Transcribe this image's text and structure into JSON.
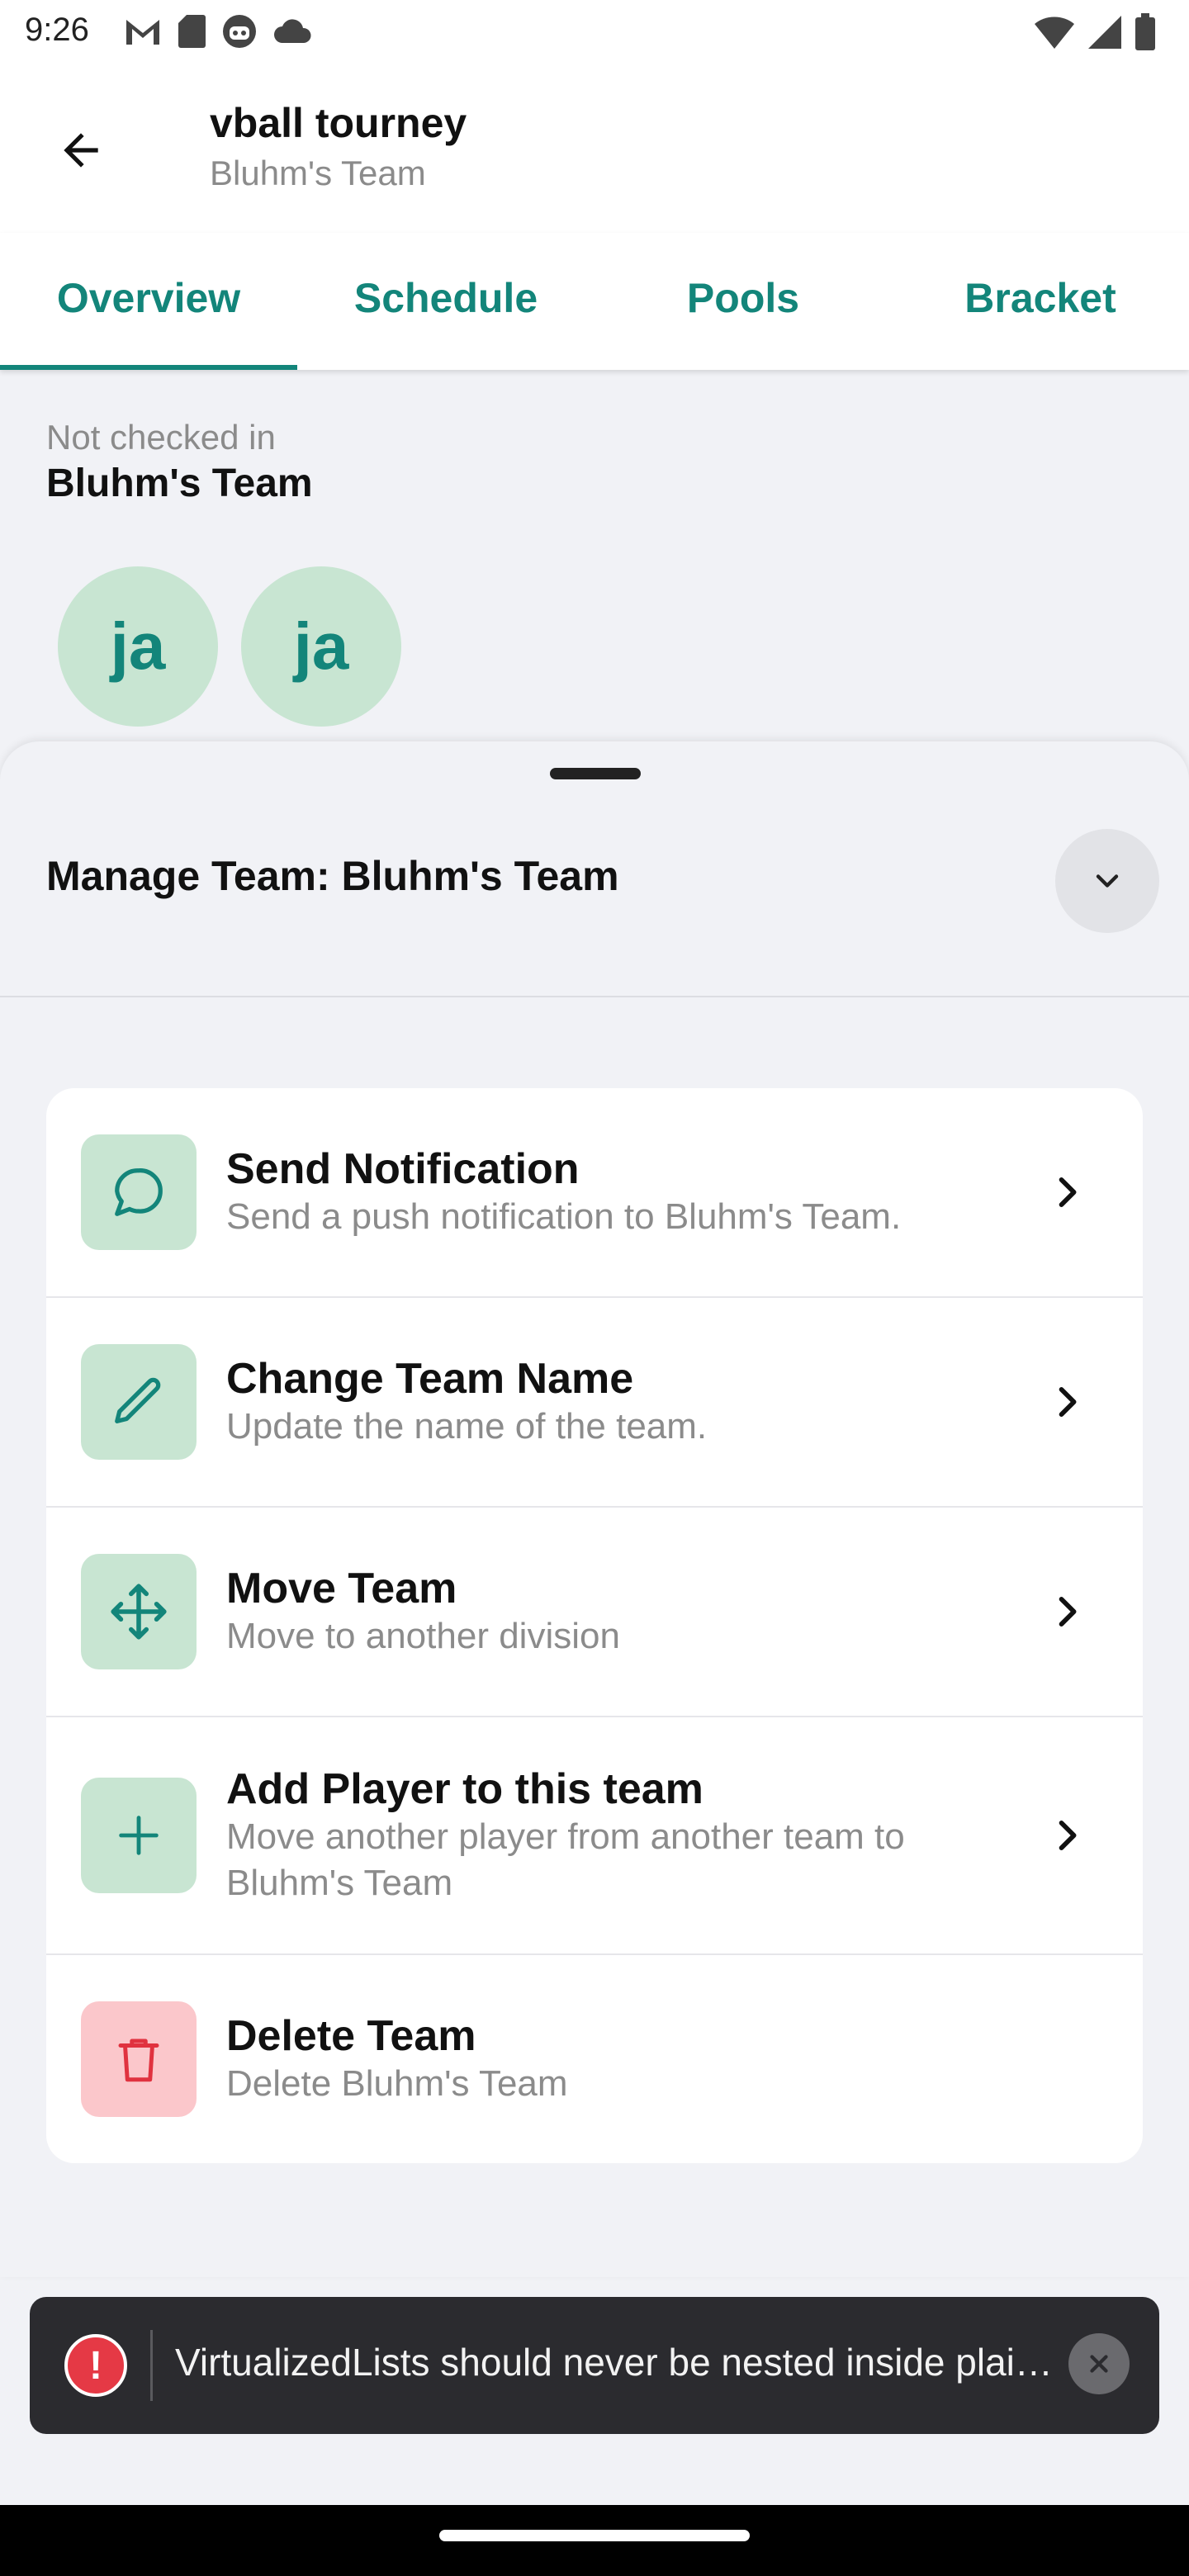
{
  "status_bar": {
    "time": "9:26",
    "left_icons": [
      "gmail-icon",
      "sd-card-icon",
      "robot-icon",
      "cloud-icon"
    ],
    "right_icons": [
      "wifi-icon",
      "signal-icon",
      "battery-icon"
    ]
  },
  "app_bar": {
    "title": "vball tourney",
    "subtitle": "Bluhm's Team"
  },
  "tabs": [
    {
      "label": "Overview",
      "active": true
    },
    {
      "label": "Schedule",
      "active": false
    },
    {
      "label": "Pools",
      "active": false
    },
    {
      "label": "Bracket",
      "active": false
    }
  ],
  "team": {
    "checkin_status": "Not checked in",
    "name": "Bluhm's Team",
    "avatars": [
      "ja",
      "ja"
    ]
  },
  "sheet": {
    "title": "Manage Team: Bluhm's Team",
    "items": [
      {
        "icon": "chat-bubble-icon",
        "label": "Send Notification",
        "desc": "Send a push notification to Bluhm's Team."
      },
      {
        "icon": "pencil-icon",
        "label": "Change Team Name",
        "desc": "Update the name of the team."
      },
      {
        "icon": "move-arrows-icon",
        "label": "Move Team",
        "desc": "Move to another division"
      },
      {
        "icon": "plus-icon",
        "label": "Add Player to this team",
        "desc": "Move another player from another team to Bluhm's Team"
      },
      {
        "icon": "trash-icon",
        "label": "Delete Team",
        "desc": "Delete Bluhm's Team"
      }
    ]
  },
  "toast": {
    "message": "VirtualizedLists should never be nested inside plain ScrollViews with the same orientation"
  },
  "colors": {
    "accent": "#13857a",
    "icon_bg": "#c8e5d2",
    "danger": "#e0323f",
    "danger_bg": "#fbc7cb",
    "toast_bg": "#2b2b2f"
  }
}
